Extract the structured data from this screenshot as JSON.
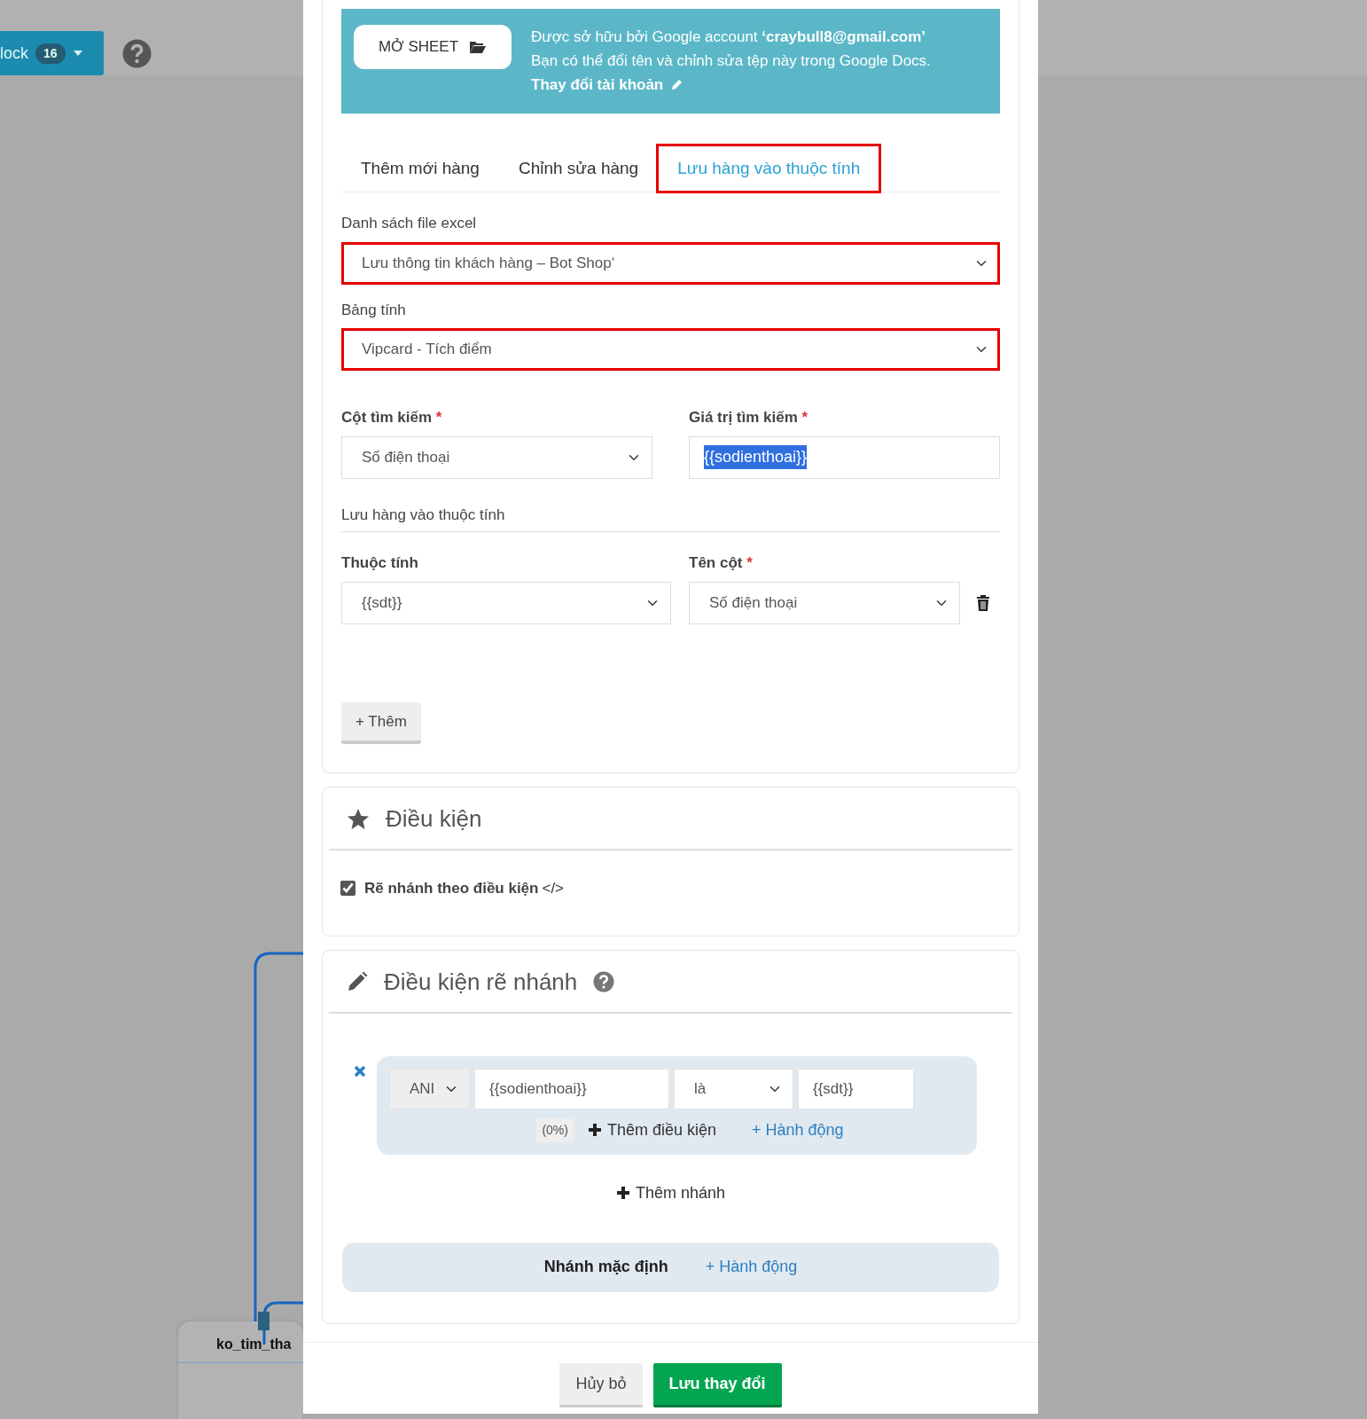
{
  "toolbar": {
    "button_label": "lock",
    "count": "16"
  },
  "canvas": {
    "node_title": "ko_tim_tha"
  },
  "modal": {
    "sheet_banner": {
      "open_button": "MỞ SHEET",
      "owner_text": "Được sở hữu bởi Google account **‘craybull8@gmail.com’**",
      "info_text": "Bạn có thể đổi tên và chỉnh sửa tệp này trong Google Docs.",
      "change_account": "Thay đổi tài khoản"
    },
    "tabs": [
      {
        "label": "Thêm mới hàng",
        "selected": false,
        "highlighted": false
      },
      {
        "label": "Chỉnh sửa hàng",
        "selected": false,
        "highlighted": false
      },
      {
        "label": "Lưu hàng vào thuộc tính",
        "selected": true,
        "highlighted": true
      }
    ],
    "file_list": {
      "label": "Danh sách file excel",
      "value": "Lưu thông tin khách hàng – Bot Shop‘",
      "highlighted": true
    },
    "sheet": {
      "label": "Bảng tính",
      "value": "Vipcard - Tích điểm",
      "highlighted": true
    },
    "search_column": {
      "label": "Cột tìm kiếm",
      "required_mark": "*",
      "value": "Số điện thoại"
    },
    "search_value": {
      "label": "Giá trị tìm kiếm",
      "required_mark": "*",
      "value": "{{sodienthoai}}",
      "text_selected": true
    },
    "save_section": {
      "title": "Lưu hàng vào thuộc tính",
      "columns": [
        {
          "label": "Thuộc tính"
        },
        {
          "label": "Tên cột",
          "required_mark": "*"
        }
      ],
      "rows": [
        {
          "attribute": "{{sdt}}",
          "column": "Số điện thoại"
        }
      ],
      "add_button": "+ Thêm"
    },
    "conditions_card": {
      "title": "Điều kiện",
      "option": {
        "label": "Rẽ nhánh theo điều kiện",
        "code_mark": "</>",
        "checked": true
      }
    },
    "branch_card": {
      "title": "Điều kiện rẽ nhánh",
      "branches": [
        {
          "conditions": [
            {
              "logic": "ANI",
              "left": "{{sodienthoai}}",
              "operator": "là",
              "right": "{{sdt}}"
            }
          ],
          "percent": "(0%)",
          "add_condition": "Thêm điều kiện",
          "add_action": "+ Hành động"
        }
      ],
      "add_branch": "Thêm nhánh",
      "default_branch": {
        "label": "Nhánh mặc định",
        "add_action": "+ Hành động"
      }
    },
    "footer": {
      "buttons": [
        {
          "label": "Hủy bỏ",
          "kind": "secondary"
        },
        {
          "label": "Lưu thay đổi",
          "kind": "primary"
        }
      ]
    }
  }
}
